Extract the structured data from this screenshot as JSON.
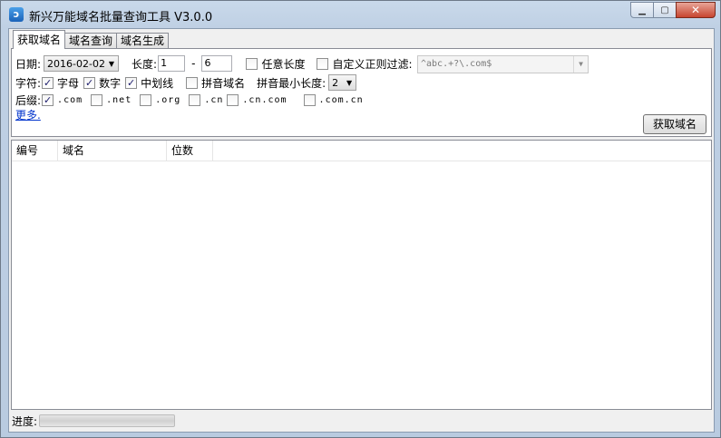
{
  "window": {
    "title": "新兴万能域名批量查询工具 V3.0.0",
    "icon": "app-logo-icon",
    "controls": {
      "minimize": "minimize-icon",
      "maximize": "maximize-icon",
      "close": "close-icon"
    }
  },
  "tabs": [
    {
      "label": "获取域名",
      "active": true
    },
    {
      "label": "域名查询",
      "active": false
    },
    {
      "label": "域名生成",
      "active": false
    }
  ],
  "form": {
    "date_label": "日期:",
    "date_value": "2016-02-02",
    "length_label": "长度:",
    "length_min": "1",
    "length_sep": "-",
    "length_max": "6",
    "any_length_label": "任意长度",
    "any_length_checked": false,
    "regex_label": "自定义正则过滤:",
    "regex_value": "^abc.+?\\.com$",
    "chars_label": "字符:",
    "chars": [
      {
        "label": "字母",
        "checked": true
      },
      {
        "label": "数字",
        "checked": true
      },
      {
        "label": "中划线",
        "checked": true
      }
    ],
    "pinyin_label": "拼音域名",
    "pinyin_checked": false,
    "pinyin_min_label": "拼音最小长度:",
    "pinyin_min_value": "2",
    "suffix_label": "后缀:",
    "suffixes": [
      {
        "label": ".com",
        "checked": true
      },
      {
        "label": ".net",
        "checked": false
      },
      {
        "label": ".org",
        "checked": false
      },
      {
        "label": ".cn",
        "checked": false
      },
      {
        "label": ".cn.com",
        "checked": false
      },
      {
        "label": ".com.cn",
        "checked": false
      }
    ],
    "more_link": "更多.",
    "fetch_button": "获取域名"
  },
  "table": {
    "columns": [
      "编号",
      "域名",
      "位数"
    ],
    "rows": []
  },
  "status": {
    "progress_label": "进度:",
    "progress": 0
  }
}
